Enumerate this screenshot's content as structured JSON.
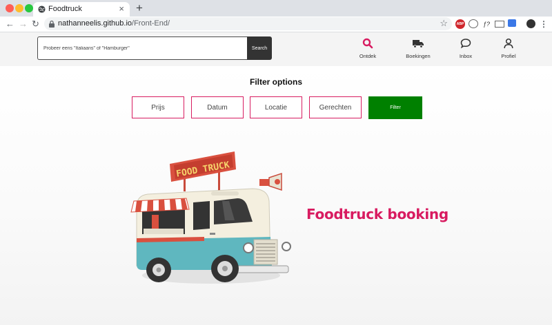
{
  "browser": {
    "tab_title": "Foodtruck",
    "tab_close": "×",
    "new_tab": "+",
    "url_domain": "nathanneelis.github.io",
    "url_path": "/Front-End/",
    "extensions": [
      "ABP",
      "ƒ?"
    ]
  },
  "header": {
    "search_placeholder": "Probeer eens \"Italiaans\" of \"Hamburger\"",
    "search_button": "Search",
    "nav": [
      {
        "label": "Ontdek",
        "icon": "search-icon",
        "active": true
      },
      {
        "label": "Boekingen",
        "icon": "truck-icon",
        "active": false
      },
      {
        "label": "Inbox",
        "icon": "chat-bubble-icon",
        "active": false
      },
      {
        "label": "Profiel",
        "icon": "user-icon",
        "active": false
      }
    ]
  },
  "filters": {
    "title": "Filter options",
    "options": [
      "Prijs",
      "Datum",
      "Locatie",
      "Gerechten"
    ],
    "submit": "Filter"
  },
  "hero": {
    "sign_text": "FOOD TRUCK",
    "title": "Foodtruck booking"
  },
  "colors": {
    "accent": "#d81b60",
    "filter_green": "#008000",
    "search_button": "#333333",
    "truck_teal": "#5fb7bf",
    "truck_cream": "#f4efdf",
    "sign_red": "#d9503f"
  }
}
